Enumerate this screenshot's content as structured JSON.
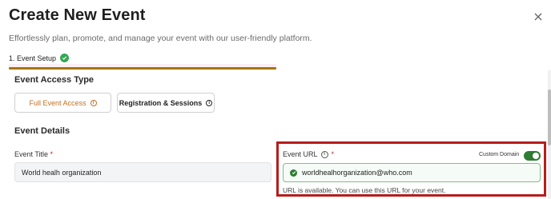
{
  "header": {
    "title": "Create New Event",
    "subtitle": "Effortlessly plan, promote, and manage your event with our user-friendly platform."
  },
  "step": {
    "label": "1. Event Setup",
    "status_icon": "check-circle-icon",
    "status_color": "#34a853"
  },
  "event_access": {
    "heading": "Event Access Type",
    "options": [
      {
        "label": "Full Event Access",
        "selected": true
      },
      {
        "label": "Registration & Sessions",
        "selected": false
      }
    ],
    "accent_color": "#c4701f"
  },
  "event_details": {
    "heading": "Event Details",
    "title_field": {
      "label": "Event Title",
      "required_mark": "*",
      "value": "World healh organization"
    },
    "url_field": {
      "label": "Event URL",
      "required_mark": "*",
      "custom_domain_label": "Custom Domain",
      "custom_domain_enabled": true,
      "value": "worldhealhorganization@who.com",
      "status_text": "URL is available. You can use this URL for your event.",
      "valid_color": "#2e7d32"
    }
  },
  "highlight_color": "#b71c1c"
}
